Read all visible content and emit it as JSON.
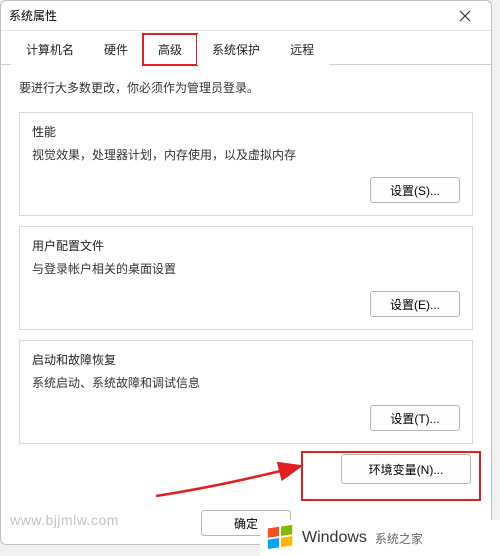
{
  "window": {
    "title": "系统属性"
  },
  "tabs": {
    "items": [
      {
        "label": "计算机名"
      },
      {
        "label": "硬件"
      },
      {
        "label": "高级"
      },
      {
        "label": "系统保护"
      },
      {
        "label": "远程"
      }
    ],
    "active_index": 2,
    "highlighted_index": 2
  },
  "note": "要进行大多数更改，你必须作为管理员登录。",
  "groups": {
    "performance": {
      "legend": "性能",
      "desc": "视觉效果，处理器计划，内存使用，以及虚拟内存",
      "button": "设置(S)..."
    },
    "user_profile": {
      "legend": "用户配置文件",
      "desc": "与登录帐户相关的桌面设置",
      "button": "设置(E)..."
    },
    "startup": {
      "legend": "启动和故障恢复",
      "desc": "系统启动、系统故障和调试信息",
      "button": "设置(T)..."
    }
  },
  "env_button": "环境变量(N)...",
  "footer": {
    "ok": "确定"
  },
  "watermark": {
    "url": "www.bjjmlw.com",
    "brand": "Windows",
    "sub": "系统之家"
  },
  "colors": {
    "highlight": "#e02020",
    "arrow": "#e02020"
  },
  "icons": {
    "close": "close-icon",
    "windows_logo": "windows-logo-icon"
  }
}
